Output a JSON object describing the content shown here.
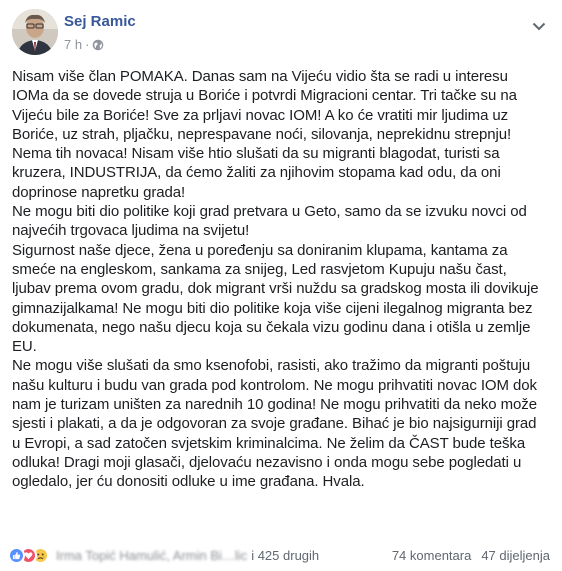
{
  "post": {
    "author": "Sej Ramic",
    "time": "7 h",
    "separator": "·",
    "paragraphs": [
      "Nisam više član POMAKA. Danas sam na Vijeću vidio šta se radi u interesu IOMa da se dovede struja u Boriće i potvrdi Migracioni centar. Tri tačke su na Vijeću bile za Boriće! Sve za prljavi novac IOM! A ko će vratiti mir ljudima uz Boriće, uz strah, pljačku, neprespavane noći, silovanja, neprekidnu strepnju! Nema tih novaca! Nisam više htio slušati da su migranti blagodat, turisti sa kruzera, INDUSTRIJA, da ćemo žaliti za njihovim stopama kad odu, da oni doprinose napretku grada!",
      "Ne mogu biti dio politike koji grad pretvara u Geto, samo da se izvuku novci od najvećih trgovaca ljudima na svijetu!",
      "Sigurnost naše djece, žena u poređenju sa doniranim klupama, kantama za smeće na engleskom, sankama za snijeg, Led rasvjetom Kupuju našu čast, ljubav prema ovom gradu, dok migrant vrši nuždu sa gradskog mosta ili dovikuje gimnazijalkama! Ne mogu biti dio politike koja više cijeni ilegalnog migranta bez dokumenata, nego našu djecu koja su čekala vizu godinu dana i otišla u zemlje EU.",
      "Ne mogu više slušati da smo ksenofobi, rasisti, ako tražimo da migranti poštuju našu kulturu i budu van grada pod kontrolom. Ne mogu prihvatiti novac IOM dok nam je turizam uništen za narednih 10 godina! Ne mogu prihvatiti da neko može sjesti i plakati, a da je odgovoran za svoje građane. Bihać je bio najsigurniji grad u Evropi, a sad zatočen svjetskim kriminalcima. Ne želim da ČAST bude teška odluka! Dragi moji glasači, djelovaću nezavisno i onda mogu sebe pogledati u ogledalo, jer ću donositi odluke u ime građana. Hvala."
    ]
  },
  "footer": {
    "reactors_blurred": "Irma Topić Hamulić, Armin Bi…lic",
    "others": "i 425 drugih",
    "comments": "74 komentara",
    "shares": "47 dijeljenja"
  },
  "icons": {
    "privacy": "globe-icon",
    "menu": "chevron-down-icon",
    "reactions": [
      "like-icon",
      "love-icon",
      "sad-icon"
    ]
  },
  "colors": {
    "author": "#385898",
    "meta": "#90949c",
    "text": "#1c1e21",
    "like": "#5890ff",
    "love": "#f25268",
    "sad": "#f7c94b"
  }
}
